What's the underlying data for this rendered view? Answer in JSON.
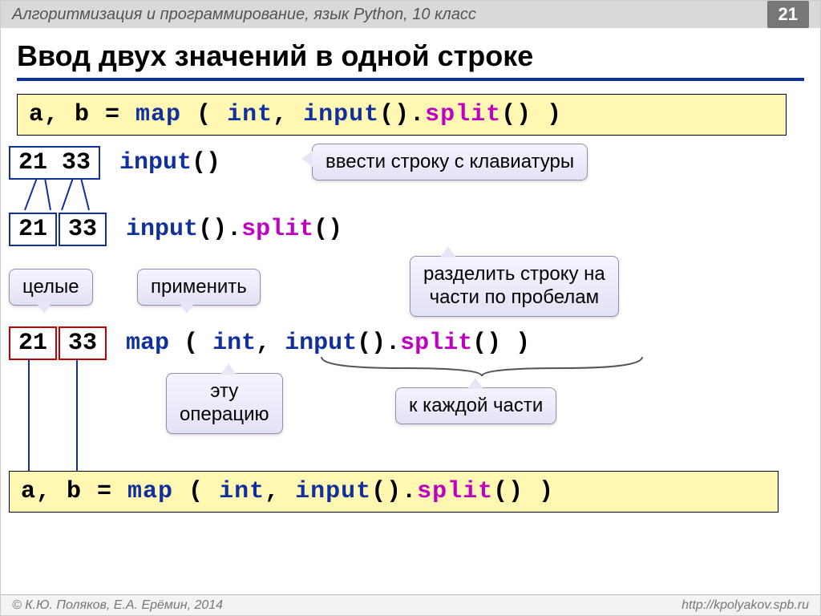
{
  "topbar": {
    "title": "Алгоритмизация и программирование, язык Python, 10 класс",
    "pagenum": "21"
  },
  "heading": "Ввод двух значений в одной строке",
  "code_top": {
    "pre": "a, b = ",
    "map": "map",
    "open": " ( ",
    "int": "int",
    "mid1": ", ",
    "input": "input",
    "par": "().",
    "split": "split",
    "end": "() )"
  },
  "row1": {
    "box": "21 33",
    "code_input": "input",
    "code_paren": "()"
  },
  "lbl_input_kb": "ввести строку с клавиатуры",
  "row2": {
    "box1": "21",
    "box2": "33",
    "code_input": "input",
    "par1": "().",
    "split": "split",
    "par2": "()"
  },
  "lbl_whole": "целые",
  "lbl_apply": "применить",
  "lbl_splitspaces1": "разделить строку на",
  "lbl_splitspaces2": "части по пробелам",
  "row3": {
    "box1": "21",
    "box2": "33",
    "map": "map",
    "open": " ( ",
    "int": "int",
    "mid": ", ",
    "input": "input",
    "par1": "().",
    "split": "split",
    "end": "() )"
  },
  "lbl_thisop1": "эту",
  "lbl_thisop2": "операцию",
  "lbl_eachpart": "к каждой части",
  "footer": {
    "left": "© К.Ю. Поляков, Е.А. Ерёмин, 2014",
    "right": "http://kpolyakov.spb.ru"
  }
}
